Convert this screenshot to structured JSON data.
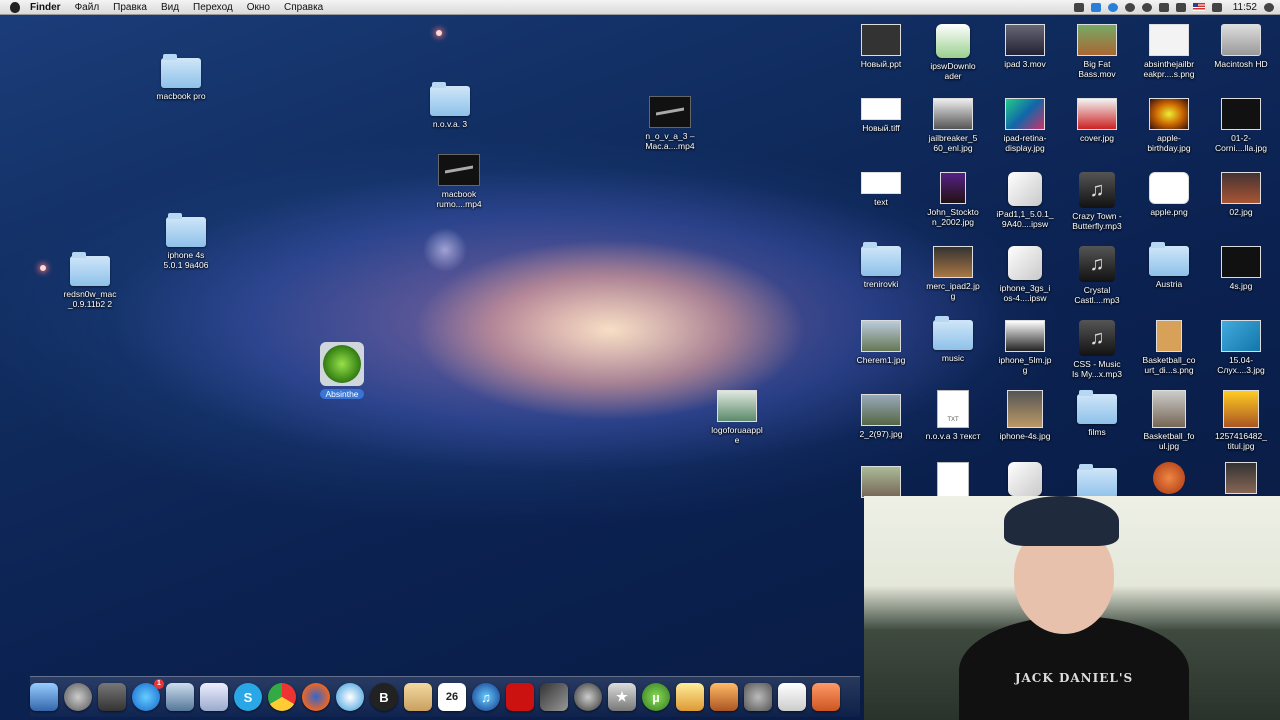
{
  "menubar": {
    "app_name": "Finder",
    "menus": [
      "Файл",
      "Правка",
      "Вид",
      "Переход",
      "Окно",
      "Справка"
    ],
    "clock": "11:52",
    "status_icons": [
      "screen-icon",
      "twitter-icon",
      "skype-icon",
      "sync-icon",
      "time-machine-icon",
      "bluetooth-icon",
      "wifi-icon",
      "us-flag-icon",
      "volume-icon"
    ]
  },
  "desktop_left": {
    "macbook_pro": "macbook pro",
    "nova3": "n.o.v.a. 3",
    "nova3_mac": "n_o_v_a_3 –\nMac.a....mp4",
    "macbook_rumo": "macbook\nrumo....mp4",
    "iphone4s": "iphone 4s\n5.0.1 9a406",
    "redsn0w": "redsn0w_mac\n_0.9.11b2 2",
    "absinthe": "Absinthe",
    "logoforua": "logoforuaappl\ne"
  },
  "desktop_right": {
    "r1": [
      "Новый.ppt",
      "ipswDownlo\nader",
      "ipad 3.mov",
      "Big Fat\nBass.mov",
      "absinthejailbr\neakpr....s.png",
      "Macintosh HD"
    ],
    "r2": [
      "Новый.tiff",
      "jailbreaker_5\n60_enl.jpg",
      "ipad-retina-\ndisplay.jpg",
      "cover.jpg",
      "apple-\nbirthday.jpg",
      "01-2-\nCorni....lla.jpg"
    ],
    "r3": [
      "text",
      "John_Stockto\nn_2002.jpg",
      "iPad1,1_5.0.1_\n9A40....ipsw",
      "Crazy Town -\nButterfly.mp3",
      "apple.png",
      "02.jpg"
    ],
    "r4": [
      "trenirovki",
      "merc_ipad2.jp\ng",
      "iphone_3gs_i\nos-4....ipsw",
      "Crystal\nCastl....mp3",
      "Austria",
      "4s.jpg"
    ],
    "r5": [
      "Cherem1.jpg",
      "music",
      "iphone_5lm.jp\ng",
      "CSS - Music\nIs My...x.mp3",
      "Basketball_co\nurt_di...s.png",
      "15.04-\nСлух....3.jpg"
    ],
    "r6": [
      "2_2(97).jpg",
      "n.o.v.a 3 текст",
      "iphone-4s.jpg",
      "films",
      "Basketball_fo\nul.jpg",
      "1257416482_\ntitul.jpg"
    ]
  },
  "dock": {
    "items": [
      "finder-icon",
      "launchpad-icon",
      "mission-control-icon",
      "app-store-icon",
      "preview-icon",
      "mail-send-icon",
      "skype-icon",
      "chrome-icon",
      "firefox-icon",
      "safari-icon",
      "b-app-icon",
      "contacts-icon",
      "calendar-icon",
      "itunes-icon",
      "photo-booth-icon",
      "final-cut-icon",
      "dvd-icon",
      "imovie-icon",
      "utorrent-icon",
      "textedit-icon",
      "image-capture-icon",
      "system-preferences-icon",
      "documents-icon",
      "stack-icon"
    ],
    "calendar_day": "26",
    "appstore_badge": "1"
  },
  "webcam": {
    "shirt_text": "JACK DANIEL'S"
  },
  "colors": {
    "menubar": "#e6e6e6",
    "selection": "#3875d7",
    "folder": "#8ec1ea"
  }
}
